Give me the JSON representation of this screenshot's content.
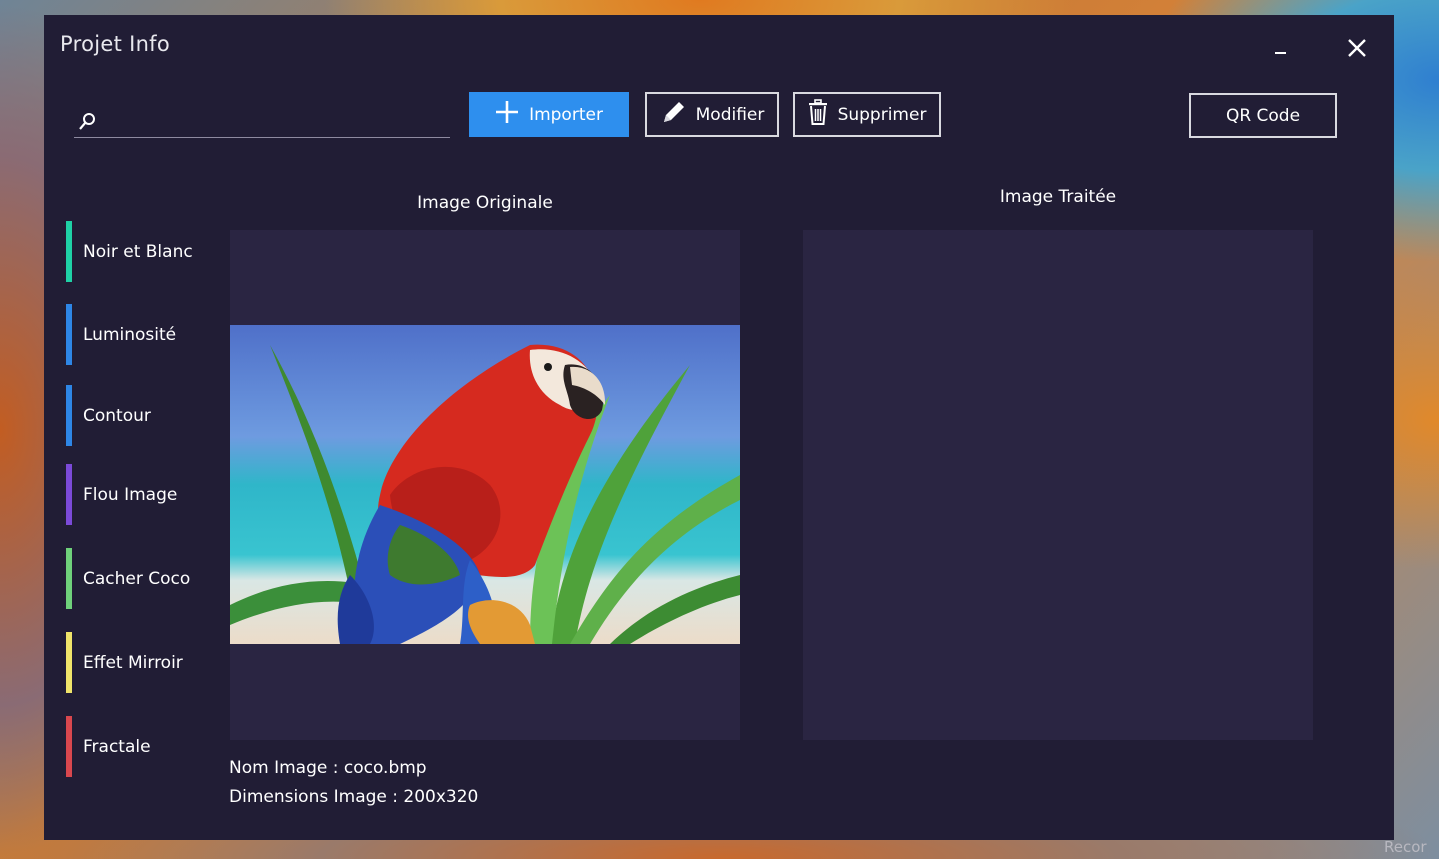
{
  "window": {
    "title": "Projet Info",
    "minimize_icon": "minimize-icon",
    "close_icon": "close-icon"
  },
  "search": {
    "value": "",
    "placeholder": "",
    "icon": "search-icon"
  },
  "toolbar": {
    "import_label": "Importer",
    "import_icon": "plus-icon",
    "edit_label": "Modifier",
    "edit_icon": "pencil-icon",
    "delete_label": "Supprimer",
    "delete_icon": "trash-icon",
    "qr_label": "QR Code",
    "accent": "#2e8fee"
  },
  "sidebar": {
    "items": [
      {
        "label": "Noir et Blanc",
        "color": "#1fd1a6"
      },
      {
        "label": "Luminosité",
        "color": "#2e86e6"
      },
      {
        "label": "Contour",
        "color": "#2e86e6"
      },
      {
        "label": "Flou Image",
        "color": "#7b4ad8"
      },
      {
        "label": "Cacher Coco",
        "color": "#6fd17b"
      },
      {
        "label": "Effet Mirroir",
        "color": "#f0e46a"
      },
      {
        "label": "Fractale",
        "color": "#d9474e"
      }
    ]
  },
  "panels": {
    "original_title": "Image Originale",
    "processed_title": "Image Traitée"
  },
  "image_info": {
    "name_line": "Nom Image : coco.bmp",
    "dimensions_line": "Dimensions Image : 200x320"
  },
  "corner_text": "Recor"
}
